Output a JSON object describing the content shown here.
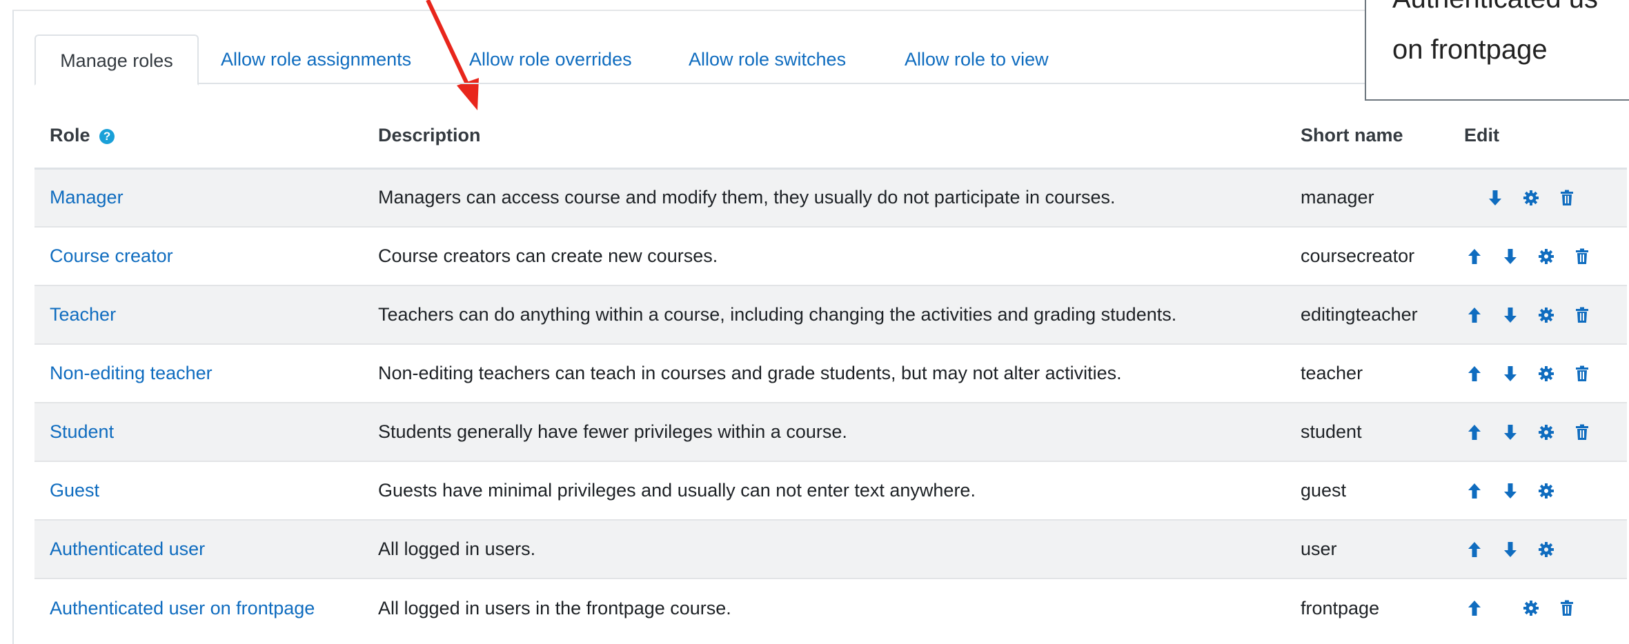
{
  "tabs": [
    {
      "label": "Manage roles",
      "active": true
    },
    {
      "label": "Allow role assignments",
      "active": false
    },
    {
      "label": "Allow role overrides",
      "active": false
    },
    {
      "label": "Allow role switches",
      "active": false
    },
    {
      "label": "Allow role to view",
      "active": false
    }
  ],
  "tooltip": {
    "line1": "Authenticated us",
    "line2": "on frontpage"
  },
  "table": {
    "headers": {
      "role": "Role",
      "description": "Description",
      "short_name": "Short name",
      "edit": "Edit"
    },
    "rows": [
      {
        "role": "Manager",
        "description": "Managers can access course and modify them, they usually do not participate in courses.",
        "short_name": "manager",
        "actions": [
          "move-down",
          "edit",
          "delete"
        ]
      },
      {
        "role": "Course creator",
        "description": "Course creators can create new courses.",
        "short_name": "coursecreator",
        "actions": [
          "move-up",
          "move-down",
          "edit",
          "delete"
        ]
      },
      {
        "role": "Teacher",
        "description": "Teachers can do anything within a course, including changing the activities and grading students.",
        "short_name": "editingteacher",
        "actions": [
          "move-up",
          "move-down",
          "edit",
          "delete"
        ]
      },
      {
        "role": "Non-editing teacher",
        "description": "Non-editing teachers can teach in courses and grade students, but may not alter activities.",
        "short_name": "teacher",
        "actions": [
          "move-up",
          "move-down",
          "edit",
          "delete"
        ]
      },
      {
        "role": "Student",
        "description": "Students generally have fewer privileges within a course.",
        "short_name": "student",
        "actions": [
          "move-up",
          "move-down",
          "edit",
          "delete"
        ]
      },
      {
        "role": "Guest",
        "description": "Guests have minimal privileges and usually can not enter text anywhere.",
        "short_name": "guest",
        "actions": [
          "move-up",
          "move-down",
          "edit"
        ]
      },
      {
        "role": "Authenticated user",
        "description": "All logged in users.",
        "short_name": "user",
        "actions": [
          "move-up",
          "move-down",
          "edit"
        ]
      },
      {
        "role": "Authenticated user on frontpage",
        "description": "All logged in users in the frontpage course.",
        "short_name": "frontpage",
        "actions": [
          "move-up",
          "edit",
          "delete"
        ]
      }
    ]
  },
  "colors": {
    "link": "#0f6cbf",
    "icon": "#0f6cbf",
    "help_icon": "#1aa0d8",
    "annotation_arrow": "#e8261c",
    "row_stripe": "#f1f2f3"
  },
  "icons": {
    "help": "question-circle-icon",
    "move_up": "arrow-up-icon",
    "move_down": "arrow-down-icon",
    "edit": "gear-icon",
    "delete": "trash-icon"
  }
}
